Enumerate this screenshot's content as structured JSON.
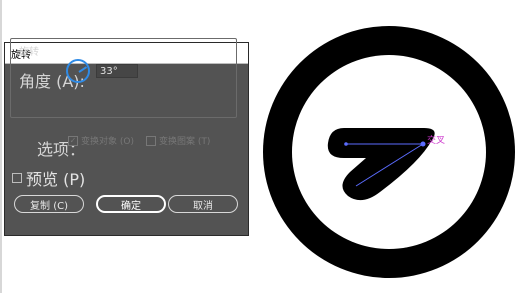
{
  "dialog": {
    "title": "旋转",
    "group_title": "旋转",
    "angle_label": "角度 (A):",
    "angle_value": "33°",
    "options_label": "选项：",
    "transform_objects": {
      "label": "变换对象 (O)",
      "checked": true,
      "enabled": false
    },
    "transform_patterns": {
      "label": "变换图案 (T)",
      "checked": false,
      "enabled": false
    },
    "preview": {
      "label": "预览 (P)",
      "checked": false
    },
    "buttons": {
      "copy": "复制 (C)",
      "ok": "确定",
      "cancel": "取消"
    }
  },
  "artwork": {
    "annotation": "交叉",
    "ring_color": "#000000",
    "guide_color": "#5b6cff",
    "annotation_color": "#cc33cc"
  }
}
